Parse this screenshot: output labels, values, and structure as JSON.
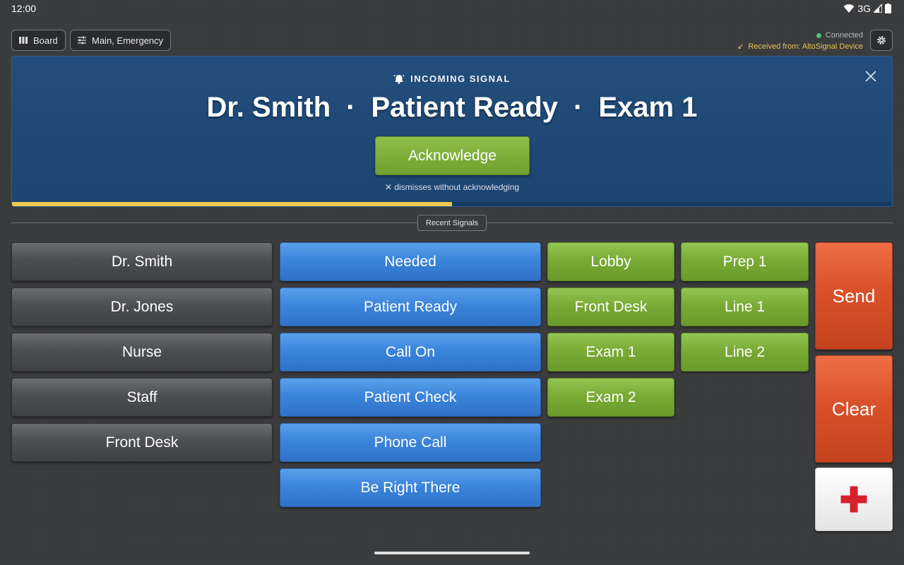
{
  "status_bar": {
    "time": "12:00",
    "network": "3G"
  },
  "top_bar": {
    "board_label": "Board",
    "channels_label": "Main, Emergency",
    "connection_status": "Connected",
    "received_from": "Received from: AltoSignal Device"
  },
  "banner": {
    "header": "INCOMING SIGNAL",
    "who": "Dr. Smith",
    "what": "Patient Ready",
    "where": "Exam 1",
    "separator": "·",
    "acknowledge_label": "Acknowledge",
    "hint": "dismisses without acknowledging",
    "timer_remaining": 0.5
  },
  "recent_signals_label": "Recent Signals",
  "people": [
    "Dr. Smith",
    "Dr. Jones",
    "Nurse",
    "Staff",
    "Front Desk"
  ],
  "messages": [
    "Needed",
    "Patient Ready",
    "Call On",
    "Patient Check",
    "Phone Call",
    "Be Right There"
  ],
  "locations_col1": [
    "Lobby",
    "Front Desk",
    "Exam 1",
    "Exam 2"
  ],
  "locations_col2": [
    "Prep 1",
    "Line 1",
    "Line 2"
  ],
  "actions": {
    "send": "Send",
    "clear": "Clear",
    "emergency_icon": "red-cross-icon"
  },
  "colors": {
    "person": "#4c4e51",
    "message": "#3b85dc",
    "location": "#79ab35",
    "action": "#d9512a",
    "banner": "#1f4875",
    "timer": "#f0c94e"
  }
}
